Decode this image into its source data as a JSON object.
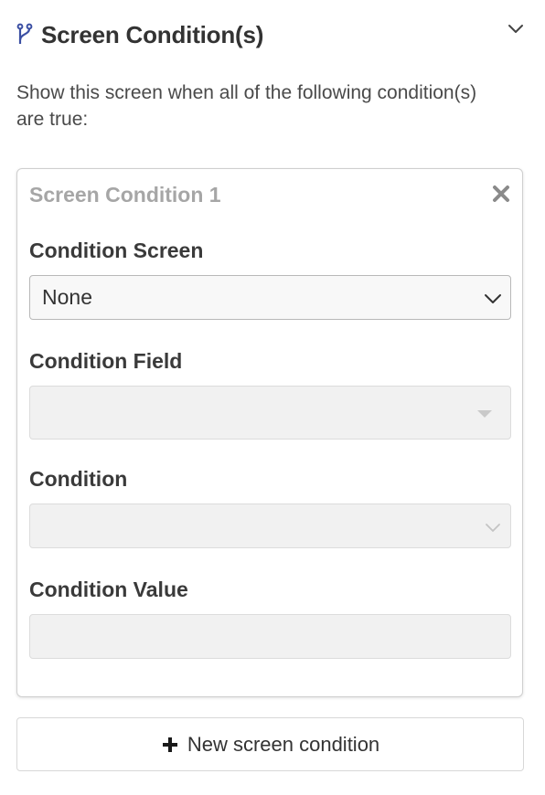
{
  "header": {
    "title": "Screen Condition(s)",
    "icon": "branch-icon",
    "toggle_icon": "chevron-down-icon"
  },
  "description": "Show this screen when all of the following condition(s) are true:",
  "condition_card": {
    "title": "Screen Condition 1",
    "close_icon": "close-icon",
    "fields": {
      "condition_screen": {
        "label": "Condition Screen",
        "value": "None"
      },
      "condition_field": {
        "label": "Condition Field",
        "value": ""
      },
      "condition": {
        "label": "Condition",
        "value": ""
      },
      "condition_value": {
        "label": "Condition Value",
        "value": ""
      }
    }
  },
  "new_condition_button": {
    "label": "New screen condition",
    "icon": "plus-icon"
  },
  "colors": {
    "accent_icon": "#3b4fa3",
    "text": "#333333",
    "muted_title": "#a6a6a6",
    "disabled_bg": "#f1f1f1"
  }
}
